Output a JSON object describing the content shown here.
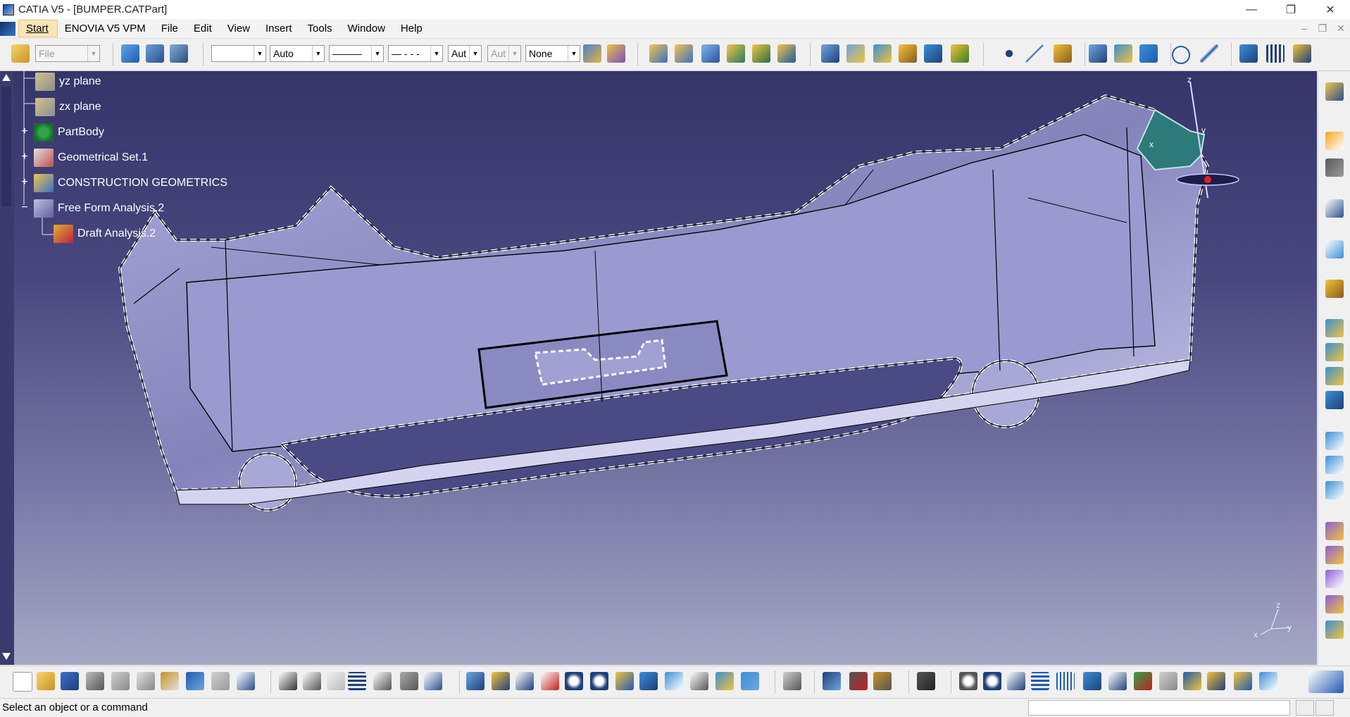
{
  "window": {
    "title": "CATIA V5 - [BUMPER.CATPart]",
    "controls": [
      "—",
      "❐",
      "✕"
    ]
  },
  "menubar": {
    "items": [
      {
        "label": "Start",
        "active": true
      },
      {
        "label": "ENOVIA V5 VPM",
        "active": false
      },
      {
        "label": "File",
        "active": false
      },
      {
        "label": "Edit",
        "active": false
      },
      {
        "label": "View",
        "active": false
      },
      {
        "label": "Insert",
        "active": false
      },
      {
        "label": "Tools",
        "active": false
      },
      {
        "label": "Window",
        "active": false
      },
      {
        "label": "Help",
        "active": false
      }
    ],
    "doc_controls": [
      "–",
      "❐",
      "✕"
    ]
  },
  "toolbar_top": {
    "file_combo": "File",
    "color_combo": "",
    "transparency_combo": "Auto",
    "linewidth_combo": "———",
    "linetype_combo": "— - - -",
    "layer_combo": "Aut",
    "render_combo": "Aut",
    "none_combo": "None"
  },
  "tree": {
    "items": [
      {
        "label": "yz plane",
        "icon": "plane-icon",
        "expander": ""
      },
      {
        "label": "zx plane",
        "icon": "plane-icon",
        "expander": ""
      },
      {
        "label": "PartBody",
        "icon": "partbody-icon",
        "expander": "+"
      },
      {
        "label": "Geometrical Set.1",
        "icon": "geometrical-set-icon",
        "expander": "+"
      },
      {
        "label": "CONSTRUCTION GEOMETRICS",
        "icon": "construction-icon",
        "expander": "+"
      },
      {
        "label": "Free Form Analysis.2",
        "icon": "freeform-analysis-icon",
        "expander": "−"
      },
      {
        "label": "Draft Analysis.2",
        "icon": "draft-analysis-icon",
        "expander": ""
      }
    ]
  },
  "compass": {
    "axes": [
      "z",
      "x",
      "y"
    ]
  },
  "axis_triad": {
    "labels": [
      "z",
      "x",
      "y"
    ]
  },
  "statusbar": {
    "message": "Select an object or a command",
    "command_input": ""
  },
  "colors": {
    "viewport_top": "#35356a",
    "viewport_bottom": "#a7a7c6",
    "part_surface": "#8e8ec4",
    "tree_text": "#ffffff"
  }
}
